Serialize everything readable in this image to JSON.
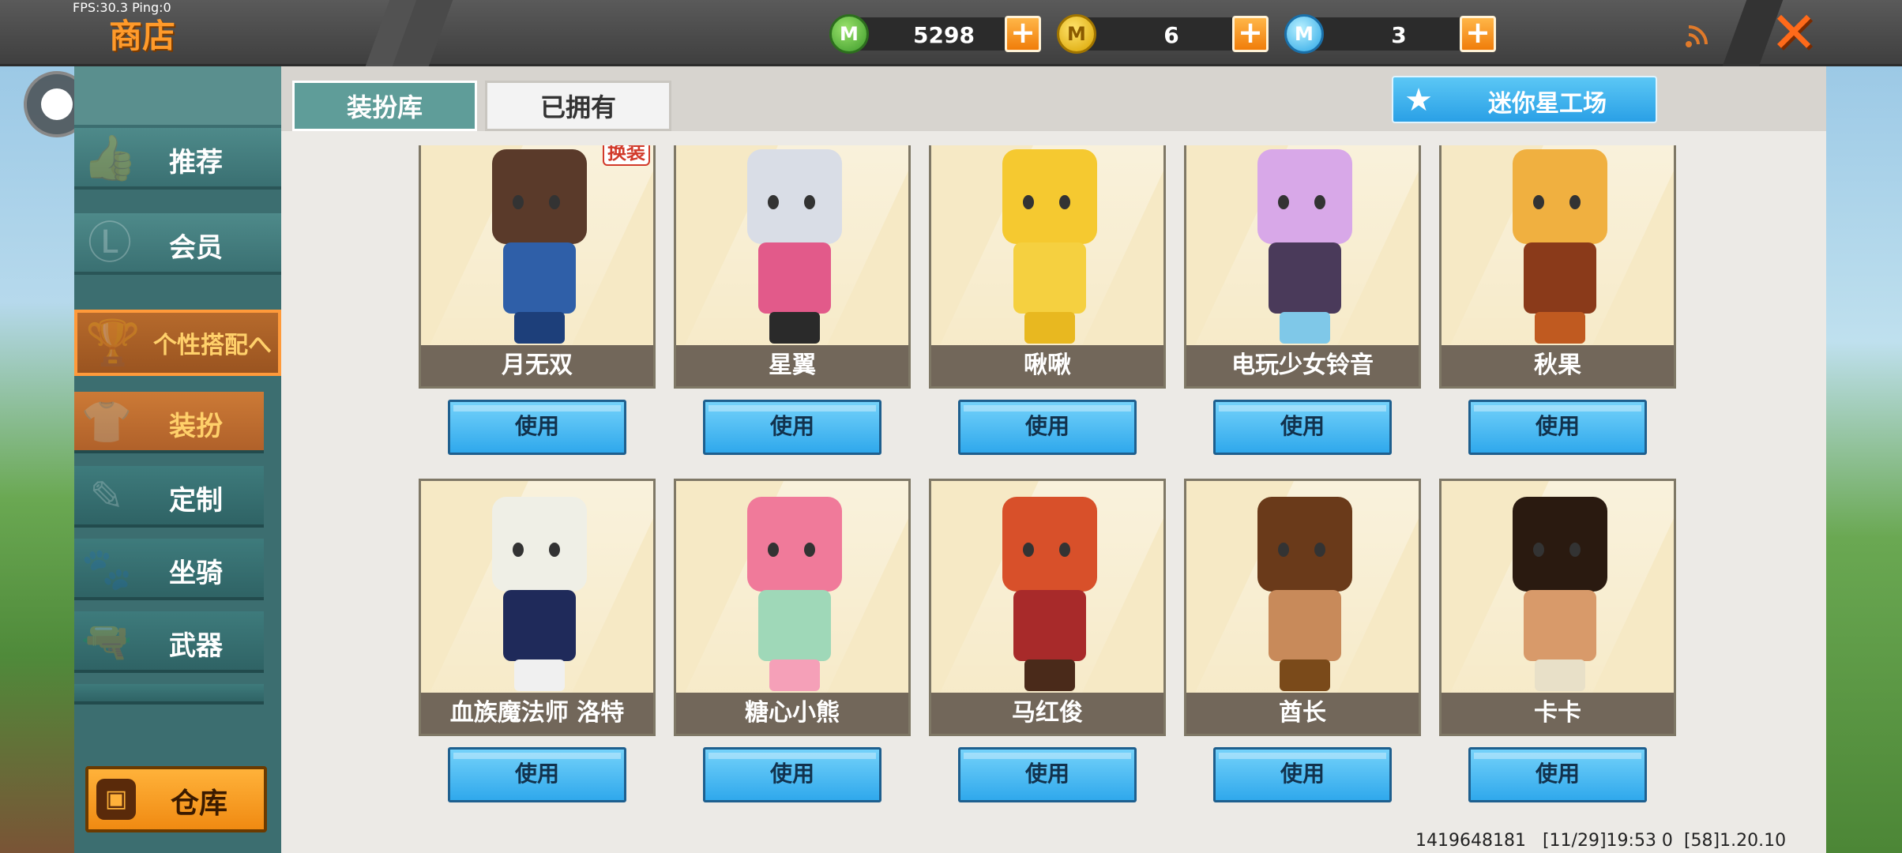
{
  "debug": {
    "fps": "FPS:30.3 Ping:0"
  },
  "header": {
    "title": "商店",
    "currencies": [
      {
        "icon": "green-coin-icon",
        "value": "5298",
        "symbol": "M"
      },
      {
        "icon": "gold-coin-icon",
        "value": "6",
        "symbol": "M"
      },
      {
        "icon": "blue-coin-icon",
        "value": "3",
        "symbol": "M"
      }
    ],
    "plus_symbol": "+",
    "close_symbol": "✕",
    "signal_icon": "signal-icon"
  },
  "sidebar": {
    "items": [
      {
        "label": "推荐",
        "icon": "thumbs-up-icon"
      },
      {
        "label": "会员",
        "icon": "membership-icon"
      },
      {
        "label": "个性搭配へ",
        "icon": "trophy-icon"
      }
    ],
    "sub_items": [
      {
        "label": "装扮",
        "icon": "outfit-icon"
      },
      {
        "label": "定制",
        "icon": "pencil-icon"
      },
      {
        "label": "坐骑",
        "icon": "mount-icon"
      },
      {
        "label": "武器",
        "icon": "gun-icon"
      }
    ],
    "warehouse_label": "仓库"
  },
  "tabs": [
    {
      "label": "装扮库"
    },
    {
      "label": "已拥有"
    }
  ],
  "workshop_label": "迷你星工场",
  "cards": [
    {
      "name": "月无双",
      "badge": "换装",
      "colors": {
        "head": "#5a3a2a",
        "body": "#2f5fa8",
        "legs": "#1d3f7a"
      }
    },
    {
      "name": "星翼",
      "colors": {
        "head": "#d9dde6",
        "body": "#e25a8a",
        "legs": "#2a2a2a"
      }
    },
    {
      "name": "啾啾",
      "colors": {
        "head": "#f5c930",
        "body": "#f5d040",
        "legs": "#e8b820"
      }
    },
    {
      "name": "电玩少女铃音",
      "colors": {
        "head": "#d8a8e8",
        "body": "#4a3a5a",
        "legs": "#7fc8e8"
      }
    },
    {
      "name": "秋果",
      "colors": {
        "head": "#f0b040",
        "body": "#8a3a1a",
        "legs": "#c05a20"
      }
    },
    {
      "name": "血族魔法师 洛特",
      "colors": {
        "head": "#efefe6",
        "body": "#1f2a5a",
        "legs": "#f0f0f0"
      }
    },
    {
      "name": "糖心小熊",
      "colors": {
        "head": "#f07a9a",
        "body": "#9fd8b8",
        "legs": "#f5a0b8"
      }
    },
    {
      "name": "马红俊",
      "colors": {
        "head": "#d8502a",
        "body": "#a82a2a",
        "legs": "#4a2a1a"
      }
    },
    {
      "name": "酋长",
      "colors": {
        "head": "#6a3a1a",
        "body": "#c88a5a",
        "legs": "#7a4a1a"
      }
    },
    {
      "name": "卡卡",
      "colors": {
        "head": "#2a1a10",
        "body": "#d89a6a",
        "legs": "#e8e0c8"
      }
    }
  ],
  "use_label": "使用",
  "footer": {
    "uid": "1419648181",
    "time": "[11/29]19:53 0",
    "version": "[58]1.20.10"
  }
}
